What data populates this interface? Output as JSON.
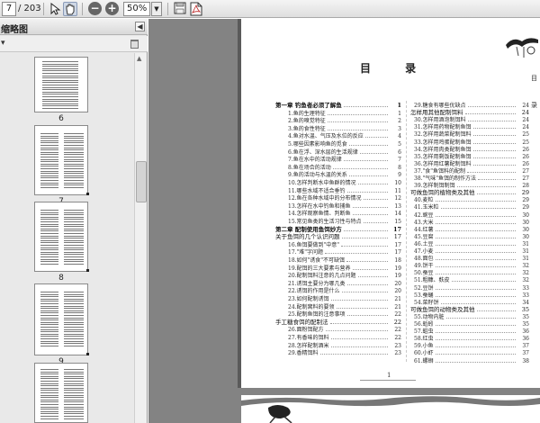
{
  "toolbar": {
    "current_page": "7",
    "page_total": "/ 203",
    "zoom": "50%",
    "icons": [
      "select-arrow-icon",
      "hand-tool-icon",
      "zoom-out-icon",
      "zoom-in-icon",
      "zoom-dropdown-icon",
      "save-icon",
      "pdf-icon"
    ]
  },
  "sidebar": {
    "title": "缩略图",
    "options_glyph": "▾",
    "close_glyph": "◀",
    "thumbnails": [
      {
        "label": "6"
      },
      {
        "label": "7"
      },
      {
        "label": "8"
      },
      {
        "label": "9"
      },
      {
        "label": ""
      }
    ]
  },
  "document": {
    "toc_title": "目 录",
    "side_text": [
      "目",
      "录"
    ],
    "page_number": "1",
    "left_column": [
      {
        "title": "第一章  钓鱼者必须了解鱼",
        "page": "1",
        "kind": "chapter"
      },
      {
        "title": "1.鱼的生理特征",
        "page": "1",
        "kind": "item"
      },
      {
        "title": "2.鱼的嗅觉特征",
        "page": "2",
        "kind": "item"
      },
      {
        "title": "3.鱼的食性特征",
        "page": "3",
        "kind": "item"
      },
      {
        "title": "4.鱼对水温、气压及水位的反应",
        "page": "4",
        "kind": "item"
      },
      {
        "title": "5.哪些因素影响鱼的觅食",
        "page": "5",
        "kind": "item"
      },
      {
        "title": "6.鱼在浮、深水层的生活规律",
        "page": "6",
        "kind": "item"
      },
      {
        "title": "7.鱼在水中的活动规律",
        "page": "7",
        "kind": "item"
      },
      {
        "title": "8.鱼在场合的活动",
        "page": "8",
        "kind": "item"
      },
      {
        "title": "9.鱼的活动与水温的关系",
        "page": "9",
        "kind": "item"
      },
      {
        "title": "10.怎样判断水中鱼群的情况",
        "page": "10",
        "kind": "item"
      },
      {
        "title": "11.哪些水域不适合垂钓",
        "page": "11",
        "kind": "item"
      },
      {
        "title": "12.鱼在各种水域中的分布情况",
        "page": "12",
        "kind": "item"
      },
      {
        "title": "13.怎样在水中钓鱼和捕鱼",
        "page": "13",
        "kind": "item"
      },
      {
        "title": "14.怎样观察鱼情、判断鱼",
        "page": "14",
        "kind": "item"
      },
      {
        "title": "15.常见鱼类的生活习性与特点",
        "page": "15",
        "kind": "item"
      },
      {
        "title": "第二章  配制使用鱼饵妙方",
        "page": "17",
        "kind": "chapter"
      },
      {
        "title": "关于鱼饵的几个认识问题",
        "page": "17",
        "kind": "section"
      },
      {
        "title": "16.鱼饵要做到\"中意\"",
        "page": "17",
        "kind": "item"
      },
      {
        "title": "17.\"难\"字问题",
        "page": "17",
        "kind": "item"
      },
      {
        "title": "18.如何\"诱食\"不可缺饵",
        "page": "18",
        "kind": "item"
      },
      {
        "title": "19.配饵的三大要素与营养",
        "page": "19",
        "kind": "item"
      },
      {
        "title": "20.配制饵料注意的几点问题",
        "page": "19",
        "kind": "item"
      },
      {
        "title": "21.诱饵主要分为哪几类",
        "page": "20",
        "kind": "item"
      },
      {
        "title": "22.诱饵的作用是什么",
        "page": "20",
        "kind": "item"
      },
      {
        "title": "23.如何配制诱饵",
        "page": "21",
        "kind": "item"
      },
      {
        "title": "24.配制窝料的要领",
        "page": "21",
        "kind": "item"
      },
      {
        "title": "25.配制鱼饵的注意事项",
        "page": "22",
        "kind": "item"
      },
      {
        "title": "手工糖食饵的配制法",
        "page": "22",
        "kind": "section"
      },
      {
        "title": "26.面粉饵配方",
        "page": "22",
        "kind": "item"
      },
      {
        "title": "27.有香味的饵料",
        "page": "22",
        "kind": "item"
      },
      {
        "title": "28.怎样配制酒米",
        "page": "23",
        "kind": "item"
      },
      {
        "title": "29.香精饵料",
        "page": "23",
        "kind": "item"
      }
    ],
    "right_column": [
      {
        "title": "29.糖食有哪些优缺点",
        "page": "24",
        "kind": "item"
      },
      {
        "title": "怎样用其他配制饵料",
        "page": "24",
        "kind": "section"
      },
      {
        "title": "30.怎样用酒泡制饵料",
        "page": "24",
        "kind": "item"
      },
      {
        "title": "31.怎样用药物配制鱼饵",
        "page": "24",
        "kind": "item"
      },
      {
        "title": "32.怎样用蔬菜配制饵料",
        "page": "25",
        "kind": "item"
      },
      {
        "title": "33.怎样用鸡蛋配制鱼饵",
        "page": "25",
        "kind": "item"
      },
      {
        "title": "34.怎样用肉类配制鱼饵",
        "page": "26",
        "kind": "item"
      },
      {
        "title": "35.怎样用剩饭配制鱼饵",
        "page": "26",
        "kind": "item"
      },
      {
        "title": "36.怎样用红薯配制饵料",
        "page": "26",
        "kind": "item"
      },
      {
        "title": "37.\"食\"鱼饵料的配制",
        "page": "27",
        "kind": "item"
      },
      {
        "title": "38.\"气味\"鱼饵的制作方法",
        "page": "27",
        "kind": "item"
      },
      {
        "title": "39.怎样制饵制饵",
        "page": "28",
        "kind": "item"
      },
      {
        "title": "可做鱼饵的植物类及其他",
        "page": "29",
        "kind": "section"
      },
      {
        "title": "40.麦粒",
        "page": "29",
        "kind": "item"
      },
      {
        "title": "41.玉米粒",
        "page": "29",
        "kind": "item"
      },
      {
        "title": "42.豌豆",
        "page": "30",
        "kind": "item"
      },
      {
        "title": "43.大米",
        "page": "30",
        "kind": "item"
      },
      {
        "title": "44.红薯",
        "page": "30",
        "kind": "item"
      },
      {
        "title": "45.豆腐",
        "page": "30",
        "kind": "item"
      },
      {
        "title": "46.土豆",
        "page": "31",
        "kind": "item"
      },
      {
        "title": "47.小麦",
        "page": "31",
        "kind": "item"
      },
      {
        "title": "48.面包",
        "page": "31",
        "kind": "item"
      },
      {
        "title": "49.饼干",
        "page": "32",
        "kind": "item"
      },
      {
        "title": "50.蚕豆",
        "page": "32",
        "kind": "item"
      },
      {
        "title": "51.粗糠、麸皮",
        "page": "32",
        "kind": "item"
      },
      {
        "title": "52.豆饼",
        "page": "33",
        "kind": "item"
      },
      {
        "title": "53.蚕蛹",
        "page": "33",
        "kind": "item"
      },
      {
        "title": "54.菜籽饼",
        "page": "34",
        "kind": "item"
      },
      {
        "title": "可做鱼饵的动物类及其他",
        "page": "35",
        "kind": "section"
      },
      {
        "title": "55.动物内脏",
        "page": "35",
        "kind": "item"
      },
      {
        "title": "56.蚯蚓",
        "page": "35",
        "kind": "item"
      },
      {
        "title": "57.蛆虫",
        "page": "36",
        "kind": "item"
      },
      {
        "title": "58.红虫",
        "page": "36",
        "kind": "item"
      },
      {
        "title": "59.小鱼",
        "page": "37",
        "kind": "item"
      },
      {
        "title": "60.小虾",
        "page": "37",
        "kind": "item"
      },
      {
        "title": "61.螺蛳",
        "page": "38",
        "kind": "item"
      }
    ]
  },
  "colors": {
    "gutter": "#838383",
    "panel": "#e9e9e9",
    "toolbar": "#e5e5e5",
    "page": "#ffffff"
  }
}
